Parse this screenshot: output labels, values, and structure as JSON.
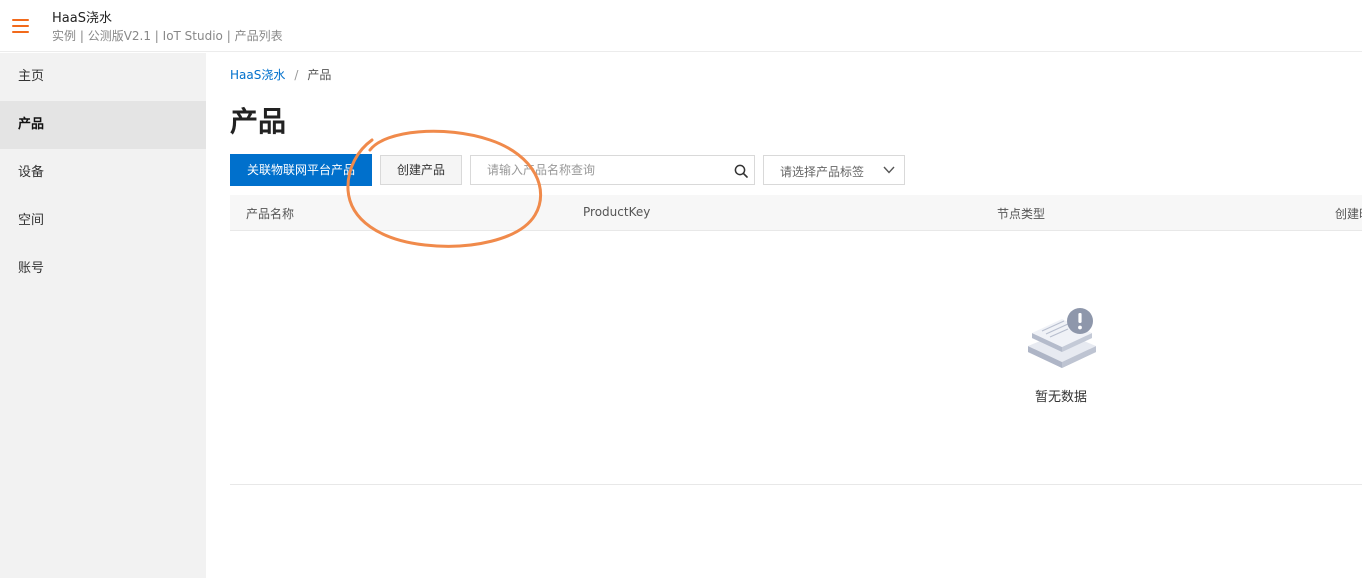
{
  "header": {
    "app_title": "HaaS浇水",
    "crumbs": [
      "实例 |",
      "公测版V2.1 | IoT Studio | 产品列表"
    ],
    "menu_icon": "hamburger-icon",
    "accent_color": "#f26a1b"
  },
  "sidebar": {
    "items": [
      {
        "label": "主页",
        "active": false
      },
      {
        "label": "产品",
        "active": true
      },
      {
        "label": "设备",
        "active": false
      },
      {
        "label": "空间",
        "active": false
      },
      {
        "label": "账号",
        "active": false
      }
    ]
  },
  "breadcrumb": {
    "project": "HaaS浇水",
    "separator": "/",
    "current": "产品"
  },
  "page": {
    "title": "产品"
  },
  "toolbar": {
    "link_product_label": "关联物联网平台产品",
    "create_product_label": "创建产品",
    "search_placeholder": "请输入产品名称查询",
    "search_icon": "search-icon",
    "tag_select_placeholder": "请选择产品标签",
    "tag_select_icon": "chevron-down-icon",
    "primary_color": "#0070cc"
  },
  "table": {
    "columns": [
      "产品名称",
      "ProductKey",
      "节点类型",
      "创建时"
    ],
    "rows": [],
    "empty_text": "暂无数据",
    "empty_icon": "empty-data-icon"
  },
  "annotation": {
    "type": "hand-drawn-circle",
    "color": "#f08a4b"
  }
}
